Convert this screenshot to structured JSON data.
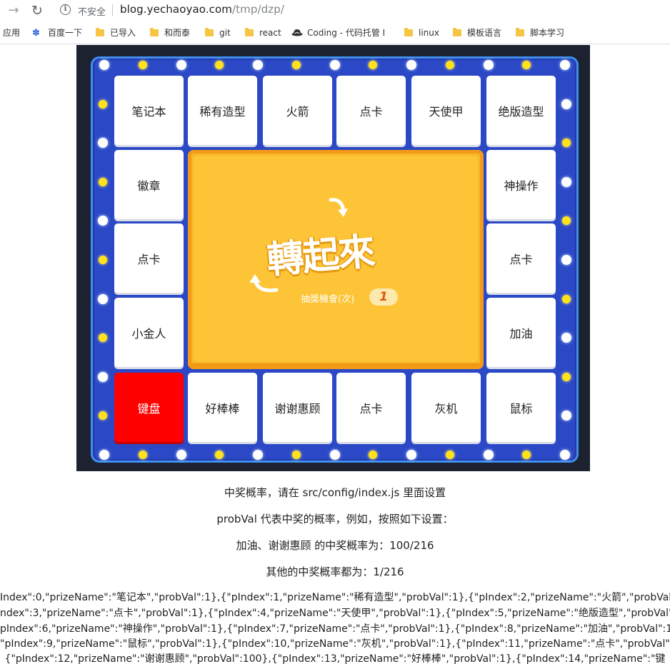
{
  "browser": {
    "security_label": "不安全",
    "url_host": "blog.yechaoyao.com",
    "url_path": "/tmp/dzp/"
  },
  "bookmarks": [
    {
      "label": "应用",
      "icon": "apps-icon"
    },
    {
      "label": "百度一下",
      "icon": "baidu-paw-icon"
    },
    {
      "label": "已导入",
      "icon": "folder-icon"
    },
    {
      "label": "和而泰",
      "icon": "folder-icon"
    },
    {
      "label": "git",
      "icon": "folder-icon"
    },
    {
      "label": "react",
      "icon": "folder-icon"
    },
    {
      "label": "Coding - 代码托管 I",
      "icon": "coding-hat-icon"
    },
    {
      "label": "linux",
      "icon": "folder-icon"
    },
    {
      "label": "模板语言",
      "icon": "folder-icon"
    },
    {
      "label": "脚本学习",
      "icon": "folder-icon"
    }
  ],
  "lottery": {
    "prizes": [
      "笔记本",
      "稀有造型",
      "火箭",
      "点卡",
      "天使甲",
      "绝版造型",
      "神操作",
      "点卡",
      "加油",
      "鼠标",
      "灰机",
      "点卡",
      "谢谢惠顾",
      "好棒棒",
      "键盘",
      "小金人",
      "点卡",
      "徽章"
    ],
    "highlighted_prize": "键盘",
    "center_title": "轉起來",
    "chance_label": "抽獎機會(次)",
    "chance_count": "1",
    "colors": {
      "board": "#2b48c6",
      "border": "#3f8ff0",
      "highlight": "#ff0000",
      "button": "#fcc436"
    }
  },
  "notes": {
    "line1": "中奖概率，请在 src/config/index.js 里面设置",
    "line2": "probVal 代表中奖的概率，例如，按照如下设置：",
    "line3": "加油、谢谢惠顾 的中奖概率为：100/216",
    "line4": "其他的中奖概率都为：1/216"
  },
  "json_dump": [
    "Index\":0,\"prizeName\":\"笔记本\",\"probVal\":1},{\"pIndex\":1,\"prizeName\":\"稀有造型\",\"probVal\":1},{\"pIndex\":2,\"prizeName\":\"火箭\",\"probVal\"",
    "ndex\":3,\"prizeName\":\"点卡\",\"probVal\":1},{\"pIndex\":4,\"prizeName\":\"天使甲\",\"probVal\":1},{\"pIndex\":5,\"prizeName\":\"绝版造型\",\"probVal\":",
    "pIndex\":6,\"prizeName\":\"神操作\",\"probVal\":1},{\"pIndex\":7,\"prizeName\":\"点卡\",\"probVal\":1},{\"pIndex\":8,\"prizeName\":\"加油\",\"probVal\":100",
    "\"pIndex\":9,\"prizeName\":\"鼠标\",\"probVal\":1},{\"pIndex\":10,\"prizeName\":\"灰机\",\"probVal\":1},{\"pIndex\":11,\"prizeName\":\"点卡\",\"probVal\":1},",
    "{\"pIndex\":12,\"prizeName\":\"谢谢惠顾\",\"probVal\":100},{\"pIndex\":13,\"prizeName\":\"好棒棒\",\"probVal\":1},{\"pIndex\":14,\"prizeName\":\"键"
  ]
}
